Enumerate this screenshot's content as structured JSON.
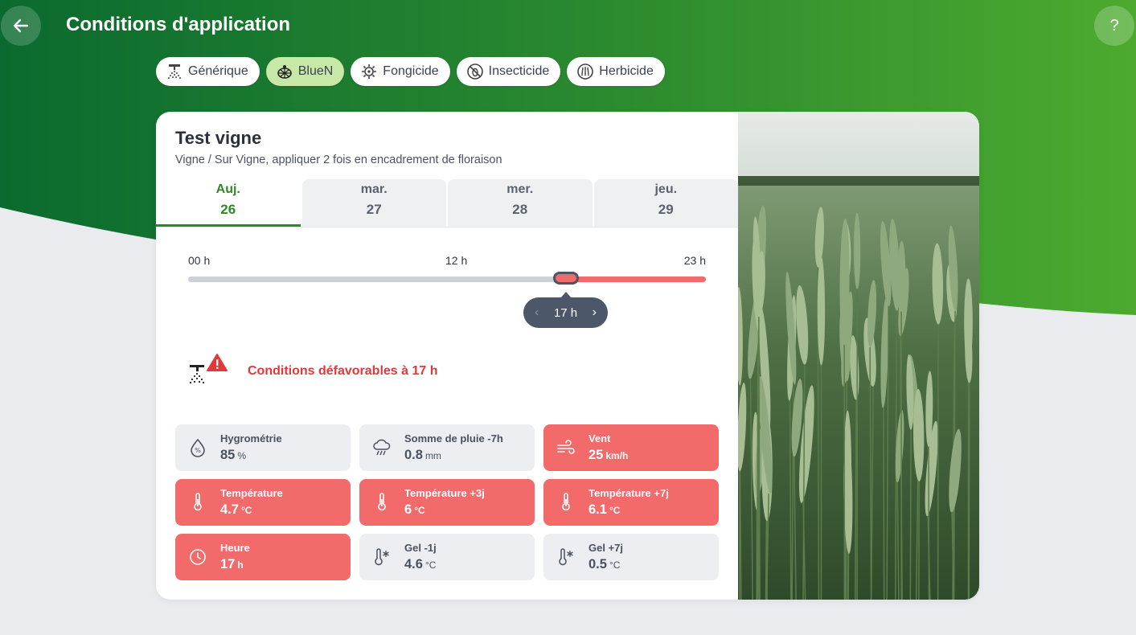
{
  "header": {
    "title": "Conditions d'application",
    "help_label": "?"
  },
  "chips": [
    {
      "label": "Générique",
      "icon": "sprayer-icon",
      "active": false
    },
    {
      "label": "BlueN",
      "icon": "bluen-icon",
      "active": true
    },
    {
      "label": "Fongicide",
      "icon": "fungicide-icon",
      "active": false
    },
    {
      "label": "Insecticide",
      "icon": "insecticide-icon",
      "active": false
    },
    {
      "label": "Herbicide",
      "icon": "herbicide-icon",
      "active": false
    }
  ],
  "card": {
    "title": "Test vigne",
    "subtitle": "Vigne / Sur Vigne, appliquer 2 fois en encadrement de floraison",
    "days": [
      {
        "name": "Auj.",
        "num": "26",
        "selected": true
      },
      {
        "name": "mar.",
        "num": "27",
        "selected": false
      },
      {
        "name": "mer.",
        "num": "28",
        "selected": false
      },
      {
        "name": "jeu.",
        "num": "29",
        "selected": false
      }
    ],
    "timeline": {
      "start_label": "00 h",
      "mid_label": "12 h",
      "end_label": "23 h",
      "selected_label": "17 h",
      "selected_hour": 17
    },
    "alert": {
      "text": "Conditions défavorables à 17 h"
    },
    "metrics": [
      {
        "label": "Hygrométrie",
        "value": "85",
        "unit": "%",
        "icon": "humidity-icon",
        "bad": false
      },
      {
        "label": "Somme de pluie -7h",
        "value": "0.8",
        "unit": "mm",
        "icon": "rain-cloud-icon",
        "bad": false
      },
      {
        "label": "Vent",
        "value": "25",
        "unit": "km/h",
        "icon": "wind-icon",
        "bad": true
      },
      {
        "label": "Température",
        "value": "4.7",
        "unit": "°C",
        "icon": "thermometer-icon",
        "bad": true
      },
      {
        "label": "Température +3j",
        "value": "6",
        "unit": "°C",
        "icon": "thermometer-icon",
        "bad": true
      },
      {
        "label": "Température +7j",
        "value": "6.1",
        "unit": "°C",
        "icon": "thermometer-icon",
        "bad": true
      },
      {
        "label": "Heure",
        "value": "17",
        "unit": "h",
        "icon": "clock-icon",
        "bad": true
      },
      {
        "label": "Gel -1j",
        "value": "4.6",
        "unit": "°C",
        "icon": "frost-thermometer-icon",
        "bad": false
      },
      {
        "label": "Gel +7j",
        "value": "0.5",
        "unit": "°C",
        "icon": "frost-thermometer-icon",
        "bad": false
      }
    ]
  },
  "colors": {
    "brand_green_dark": "#0a6b2e",
    "brand_green_light": "#4caf2c",
    "alert_red": "#e0393b",
    "bad_tile": "#f26a6a",
    "selected_day": "#2e8a22"
  }
}
